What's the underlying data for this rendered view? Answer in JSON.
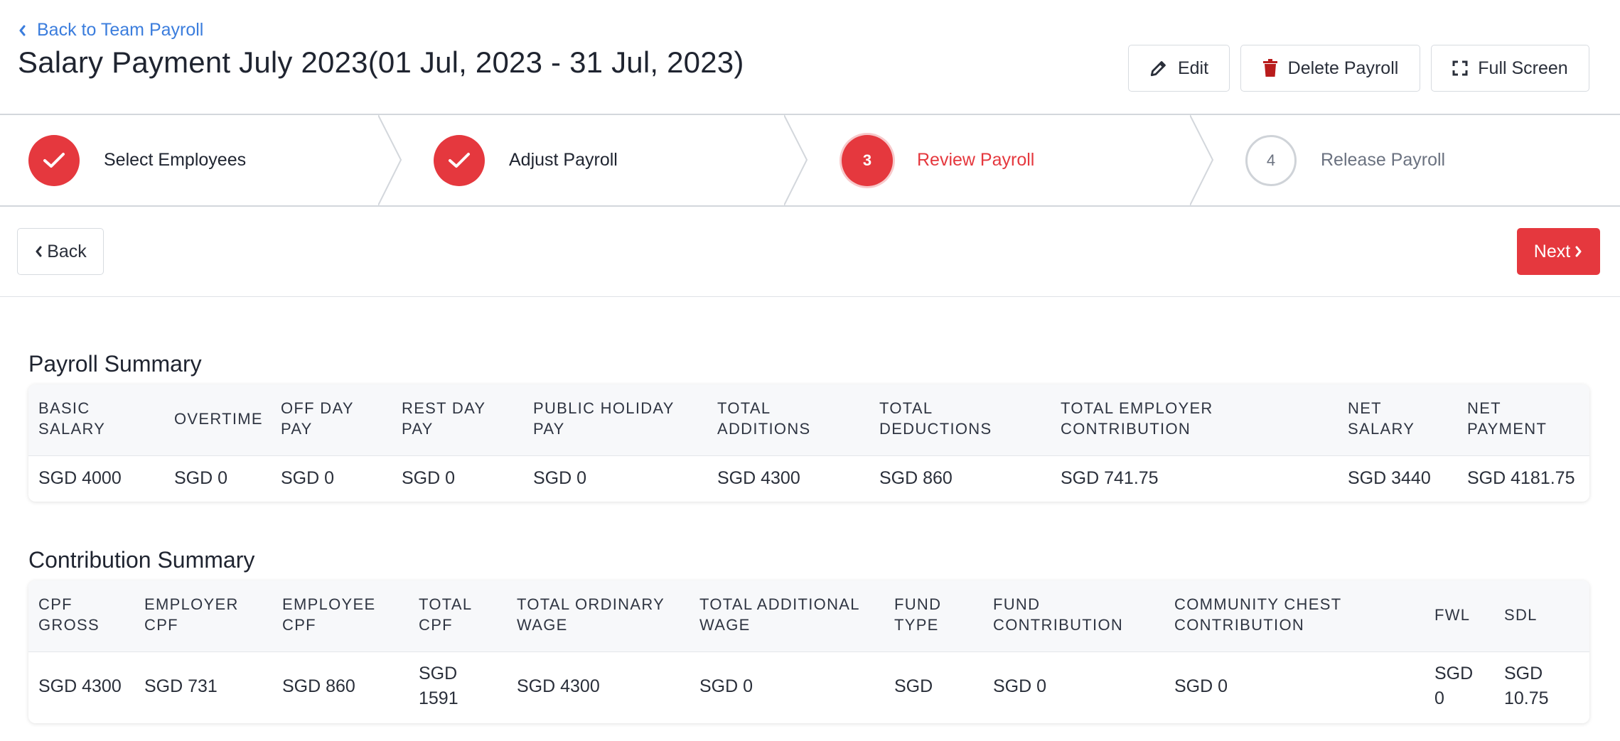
{
  "header": {
    "back_link": "Back to Team Payroll",
    "title": "Salary Payment July 2023(01 Jul, 2023 - 31 Jul, 2023)",
    "edit_label": "Edit",
    "delete_label": "Delete Payroll",
    "fullscreen_label": "Full Screen"
  },
  "steps": [
    {
      "number": "",
      "label": "Select Employees",
      "state": "done"
    },
    {
      "number": "",
      "label": "Adjust Payroll",
      "state": "done"
    },
    {
      "number": "3",
      "label": "Review Payroll",
      "state": "active"
    },
    {
      "number": "4",
      "label": "Release Payroll",
      "state": "todo"
    }
  ],
  "actions": {
    "back_label": "Back",
    "next_label": "Next"
  },
  "payroll_summary": {
    "title": "Payroll Summary",
    "headers": [
      "BASIC SALARY",
      "OVERTIME",
      "OFF DAY PAY",
      "REST DAY PAY",
      "PUBLIC HOLIDAY PAY",
      "TOTAL ADDITIONS",
      "TOTAL DEDUCTIONS",
      "TOTAL EMPLOYER CONTRIBUTION",
      "NET SALARY",
      "NET PAYMENT"
    ],
    "values": [
      "SGD 4000",
      "SGD 0",
      "SGD 0",
      "SGD 0",
      "SGD 0",
      "SGD 4300",
      "SGD 860",
      "SGD 741.75",
      "SGD 3440",
      "SGD 4181.75"
    ]
  },
  "contribution_summary": {
    "title": "Contribution Summary",
    "headers": [
      "CPF GROSS",
      "EMPLOYER CPF",
      "EMPLOYEE CPF",
      "TOTAL CPF",
      "TOTAL ORDINARY WAGE",
      "TOTAL ADDITIONAL WAGE",
      "FUND TYPE",
      "FUND CONTRIBUTION",
      "COMMUNITY CHEST CONTRIBUTION",
      "FWL",
      "SDL"
    ],
    "values": [
      "SGD 4300",
      "SGD 731",
      "SGD 860",
      "SGD 1591",
      "SGD 4300",
      "SGD 0",
      "SGD",
      "SGD 0",
      "SGD 0",
      "SGD 0",
      "SGD 10.75"
    ]
  },
  "colors": {
    "accent": "#e5383e",
    "link": "#3b7ddd",
    "muted": "#6b7280"
  }
}
